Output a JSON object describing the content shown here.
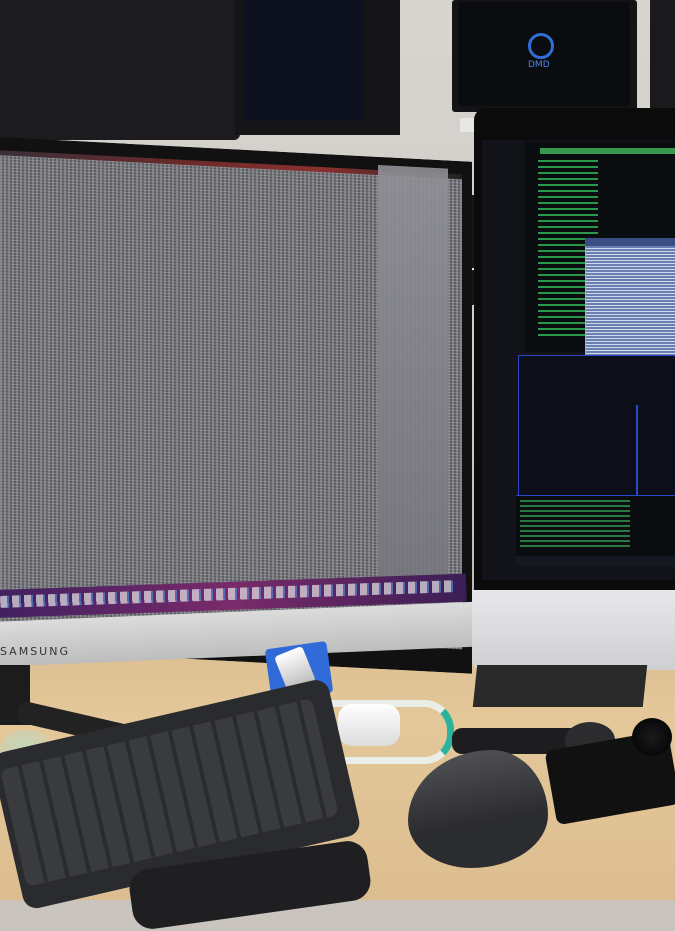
{
  "background_tv": {
    "logo_text": "DMD"
  },
  "main_monitor": {
    "brand": "SAMSUNG"
  },
  "colors": {
    "desk": "#dcbd8f",
    "terminal_green": "#34c75a",
    "terminal_blue_border": "#2a48c8",
    "usb_blue": "#2f6ad8",
    "lanyard_teal": "#2cb39c"
  }
}
